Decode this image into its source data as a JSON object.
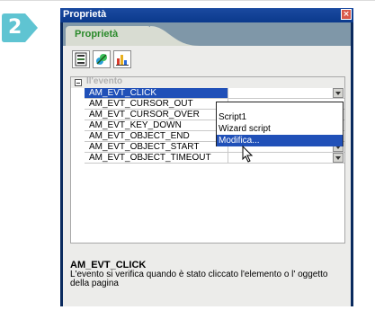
{
  "step": {
    "number": "2",
    "color": "#5fc4d2"
  },
  "window": {
    "title": "Proprietà",
    "close_icon": "close-icon"
  },
  "tab": {
    "label": "Proprietà"
  },
  "toolbar": {
    "buttons": [
      {
        "icon": "categorized-list-icon"
      },
      {
        "icon": "script-events-icon"
      },
      {
        "icon": "bar-chart-icon"
      }
    ]
  },
  "section": {
    "label": "Il'evento"
  },
  "properties": [
    {
      "name": "AM_EVT_CLICK",
      "value": ""
    },
    {
      "name": "AM_EVT_CURSOR_OUT",
      "value": ""
    },
    {
      "name": "AM_EVT_CURSOR_OVER",
      "value": ""
    },
    {
      "name": "AM_EVT_KEY_DOWN",
      "value": ""
    },
    {
      "name": "AM_EVT_OBJECT_END",
      "value": ""
    },
    {
      "name": "AM_EVT_OBJECT_START",
      "value": ""
    },
    {
      "name": "AM_EVT_OBJECT_TIMEOUT",
      "value": ""
    }
  ],
  "dropdown": {
    "options": [
      "Script1",
      "Wizard script",
      "Modifica..."
    ],
    "highlighted_index": 2
  },
  "description": {
    "title": "AM_EVT_CLICK",
    "text": "L'evento si verifica quando è stato cliccato l'elemento o l' oggetto della pagina"
  },
  "colors": {
    "selection": "#2050b8",
    "titlebar": "#0b3a8c",
    "tab_text": "#2a8a2a"
  }
}
